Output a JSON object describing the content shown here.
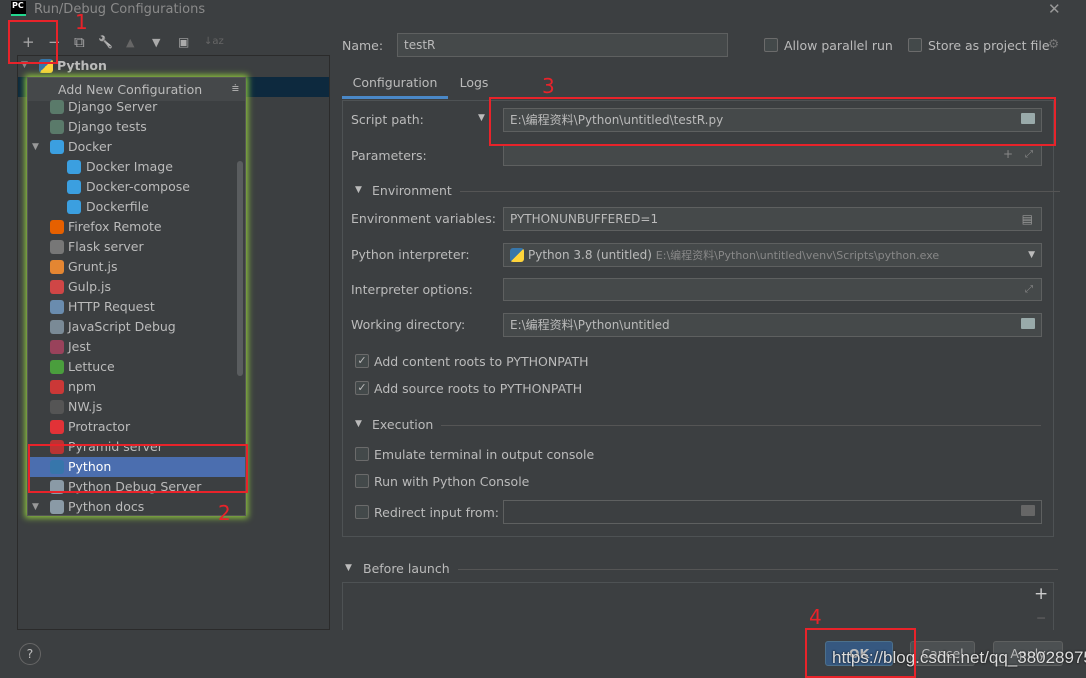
{
  "window": {
    "title": "Run/Debug Configurations",
    "logo": "PC",
    "close": "✕"
  },
  "toolbar": {
    "add": "+",
    "remove": "−",
    "copy": "⧉",
    "edit": "🔧",
    "up": "▲",
    "down": "▼",
    "folder": "▣",
    "sort": "↓az"
  },
  "tree": {
    "root": "Python"
  },
  "popup": {
    "header": "Add New Configuration",
    "items": [
      {
        "label": "Django Server",
        "icon": "django-icon",
        "color": "#5a7a6a"
      },
      {
        "label": "Django tests",
        "icon": "django-tests-icon",
        "color": "#5a7a6a"
      },
      {
        "label": "Docker",
        "icon": "docker-icon",
        "color": "#3b9fe0",
        "group": true
      },
      {
        "label": "Docker Image",
        "icon": "docker-icon",
        "color": "#3b9fe0",
        "sub": true
      },
      {
        "label": "Docker-compose",
        "icon": "docker-icon",
        "color": "#3b9fe0",
        "sub": true
      },
      {
        "label": "Dockerfile",
        "icon": "docker-icon",
        "color": "#3b9fe0",
        "sub": true
      },
      {
        "label": "Firefox Remote",
        "icon": "firefox-icon",
        "color": "#e66000"
      },
      {
        "label": "Flask server",
        "icon": "flask-icon",
        "color": "#777"
      },
      {
        "label": "Grunt.js",
        "icon": "grunt-icon",
        "color": "#e48632"
      },
      {
        "label": "Gulp.js",
        "icon": "gulp-icon",
        "color": "#cf4646"
      },
      {
        "label": "HTTP Request",
        "icon": "api-icon",
        "color": "#6a8cae"
      },
      {
        "label": "JavaScript Debug",
        "icon": "js-debug-icon",
        "color": "#7a8a96"
      },
      {
        "label": "Jest",
        "icon": "jest-icon",
        "color": "#99425b"
      },
      {
        "label": "Lettuce",
        "icon": "lettuce-icon",
        "color": "#4a9e3d"
      },
      {
        "label": "npm",
        "icon": "npm-icon",
        "color": "#cb3837"
      },
      {
        "label": "NW.js",
        "icon": "nwjs-icon",
        "color": "#555"
      },
      {
        "label": "Protractor",
        "icon": "protractor-icon",
        "color": "#e23237"
      },
      {
        "label": "Pyramid server",
        "icon": "pyramid-icon",
        "color": "#b33"
      },
      {
        "label": "Python",
        "icon": "python-icon",
        "color": "#3776ab",
        "selected": true
      },
      {
        "label": "Python Debug Server",
        "icon": "debug-server-icon",
        "color": "#8a9aa6"
      },
      {
        "label": "Python docs",
        "icon": "rst-icon",
        "color": "#8a9aa6",
        "group": true
      }
    ]
  },
  "form": {
    "name_label": "Name:",
    "name_value": "testR",
    "allow_parallel": "Allow parallel run",
    "store_project": "Store as project file",
    "tabs": [
      "Configuration",
      "Logs"
    ],
    "script_path_label": "Script path:",
    "script_path": "E:\\编程资料\\Python\\untitled\\testR.py",
    "parameters_label": "Parameters:",
    "environment": "Environment",
    "env_vars_label": "Environment variables:",
    "env_vars": "PYTHONUNBUFFERED=1",
    "interpreter_label": "Python interpreter:",
    "interpreter": "Python 3.8 (untitled)",
    "interpreter_path": "E:\\编程资料\\Python\\untitled\\venv\\Scripts\\python.exe",
    "interp_options_label": "Interpreter options:",
    "workdir_label": "Working directory:",
    "workdir": "E:\\编程资料\\Python\\untitled",
    "add_content_roots": "Add content roots to PYTHONPATH",
    "add_source_roots": "Add source roots to PYTHONPATH",
    "execution": "Execution",
    "emulate_terminal": "Emulate terminal in output console",
    "run_console": "Run with Python Console",
    "redirect_input": "Redirect input from:",
    "before_launch": "Before launch"
  },
  "buttons": {
    "ok": "OK",
    "cancel": "Cancel",
    "apply": "Apply",
    "help": "?"
  },
  "annotations": [
    "1",
    "2",
    "3",
    "4"
  ],
  "watermark": "https://blog.csdn.net/qq_38028975"
}
